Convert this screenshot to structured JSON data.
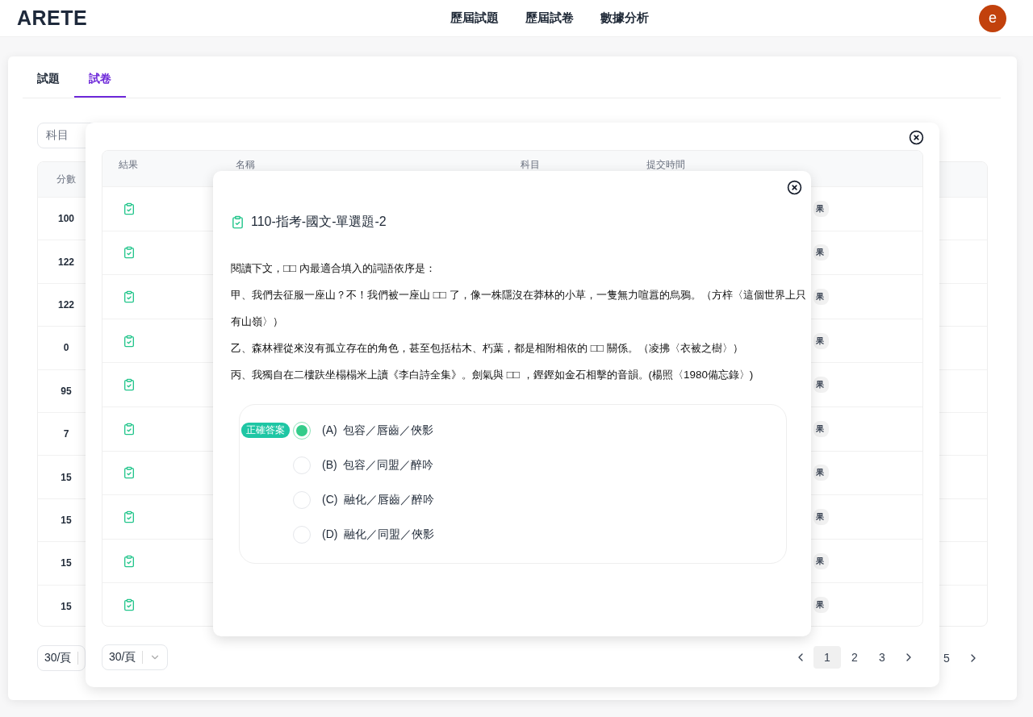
{
  "header": {
    "logo": "ARETE",
    "nav": [
      "歷屆試題",
      "歷屆試卷",
      "數據分析"
    ],
    "avatar": "e"
  },
  "tabs": [
    {
      "label": "試題",
      "selected": false
    },
    {
      "label": "試卷",
      "selected": true
    }
  ],
  "filter": {
    "placeholder": "科目"
  },
  "score_table": {
    "column": "分數",
    "rows": [
      "100",
      "122",
      "122",
      "0",
      "95",
      "7",
      "15",
      "15",
      "15",
      "15"
    ]
  },
  "page_size": "30/頁",
  "pagination": {
    "pages": [
      {
        "label": "5",
        "selected": false
      }
    ]
  },
  "results_modal": {
    "columns": [
      "結果",
      "名稱",
      "科目",
      "提交時間"
    ],
    "rows": [
      {
        "tag": "果"
      },
      {
        "tag": "果"
      },
      {
        "tag": "果"
      },
      {
        "tag": "果"
      },
      {
        "tag": "果"
      },
      {
        "tag": "果"
      },
      {
        "tag": "果"
      },
      {
        "tag": "果"
      },
      {
        "tag": "果"
      },
      {
        "tag": "果"
      }
    ],
    "page_size": "30/頁",
    "pages": [
      {
        "label": "1",
        "selected": true
      },
      {
        "label": "2",
        "selected": false
      },
      {
        "label": "3",
        "selected": false
      }
    ]
  },
  "question_modal": {
    "title": "110-指考-國文-單選題-2",
    "paragraphs": [
      "閱讀下文，□□ 內最適合填入的詞語依序是：",
      "甲、我們去征服一座山？不！我們被一座山 □□ 了，像一株隱沒在莽林的小草，一隻無力喧囂的烏鴉。（方梓〈這個世界上只有山嶺〉）",
      "乙、森林裡從來沒有孤立存在的角色，甚至包括枯木、朽葉，都是相附相依的 □□ 關係。（凌拂〈衣被之樹〉）",
      "丙、我獨自在二樓趺坐榻榻米上讀《李白詩全集》。劍氣與 □□ ，鏗鏗如金石相擊的音韻。(楊照〈1980備忘錄〉)"
    ],
    "options": [
      {
        "label": "(A)",
        "text": "包容／唇齒／俠影",
        "selected": true,
        "badge": "正確答案"
      },
      {
        "label": "(B)",
        "text": "包容／同盟／醉吟",
        "selected": false
      },
      {
        "label": "(C)",
        "text": "融化／唇齒／醉吟",
        "selected": false
      },
      {
        "label": "(D)",
        "text": "融化／同盟／俠影",
        "selected": false
      }
    ]
  }
}
